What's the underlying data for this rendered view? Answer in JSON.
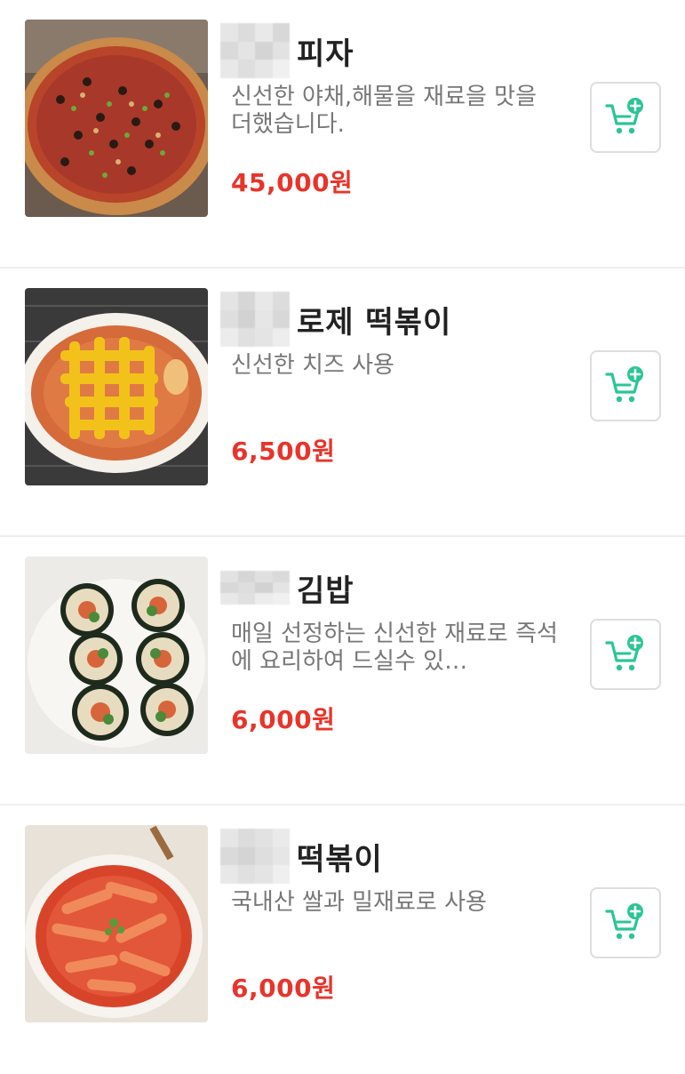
{
  "colors": {
    "accent": "#2bc596",
    "price": "#e8342a",
    "title": "#222222",
    "description": "#777777"
  },
  "menu": {
    "items": [
      {
        "name": "피자",
        "description": "신선한 야채,해물을 재료을 맛을 더했습니다.",
        "price": "45,000원",
        "image": "pizza-image",
        "icon": "add-to-cart-icon"
      },
      {
        "name": "로제 떡볶이",
        "description": "신선한 치즈 사용",
        "price": "6,500원",
        "image": "rose-tteokbokki-image",
        "icon": "add-to-cart-icon"
      },
      {
        "name": "김밥",
        "description": "매일 선정하는 신선한 재료로 즉석에 요리하여 드실수 있…",
        "price": "6,000원",
        "image": "gimbap-image",
        "icon": "add-to-cart-icon"
      },
      {
        "name": "떡볶이",
        "description": "국내산 쌀과 밀재료로 사용",
        "price": "6,000원",
        "image": "tteokbokki-image",
        "icon": "add-to-cart-icon"
      }
    ]
  }
}
